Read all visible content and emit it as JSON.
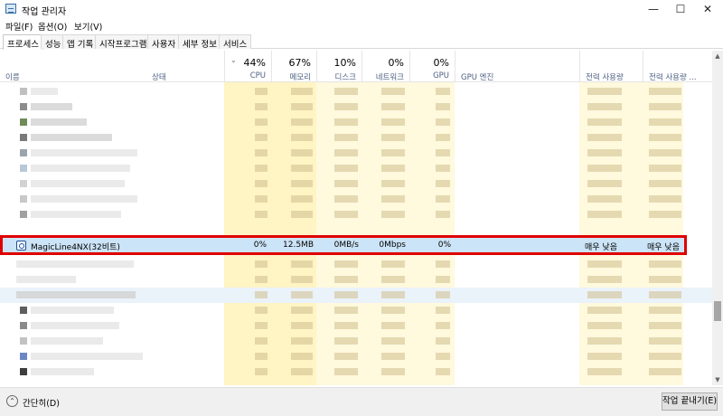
{
  "window": {
    "title": "작업 관리자",
    "controls": {
      "minimize": "—",
      "maximize": "☐",
      "close": "✕"
    }
  },
  "menu": [
    {
      "label": "파일(F)"
    },
    {
      "label": "옵션(O)"
    },
    {
      "label": "보기(V)"
    }
  ],
  "tabs": [
    {
      "label": "프로세스",
      "active": true
    },
    {
      "label": "성능"
    },
    {
      "label": "앱 기록"
    },
    {
      "label": "시작프로그램"
    },
    {
      "label": "사용자"
    },
    {
      "label": "세부 정보"
    },
    {
      "label": "서비스"
    }
  ],
  "columns": {
    "name": "이름",
    "status": "상태",
    "cpu": {
      "pct": "44%",
      "label": "CPU"
    },
    "memory": {
      "pct": "67%",
      "label": "메모리"
    },
    "disk": {
      "pct": "10%",
      "label": "디스크"
    },
    "network": {
      "pct": "0%",
      "label": "네트워크"
    },
    "gpu": {
      "pct": "0%",
      "label": "GPU"
    },
    "gpu_engine": "GPU 엔진",
    "power": "전력 사용량",
    "power_trend": "전력 사용량 ..."
  },
  "highlighted_process": {
    "name": "MagicLine4NX(32비트)",
    "cpu": "0%",
    "memory": "12.5MB",
    "disk": "0MB/s",
    "network": "0Mbps",
    "gpu": "0%",
    "power": "매우 낮음",
    "power_trend": "매우 낮음"
  },
  "footer": {
    "collapse_label": "간단히(D)",
    "end_task_label": "작업 끝내기(E)"
  },
  "colors": {
    "highlight_border": "#e00000",
    "selected_row": "#cce4f7",
    "heat_column": "#fff4c4"
  }
}
